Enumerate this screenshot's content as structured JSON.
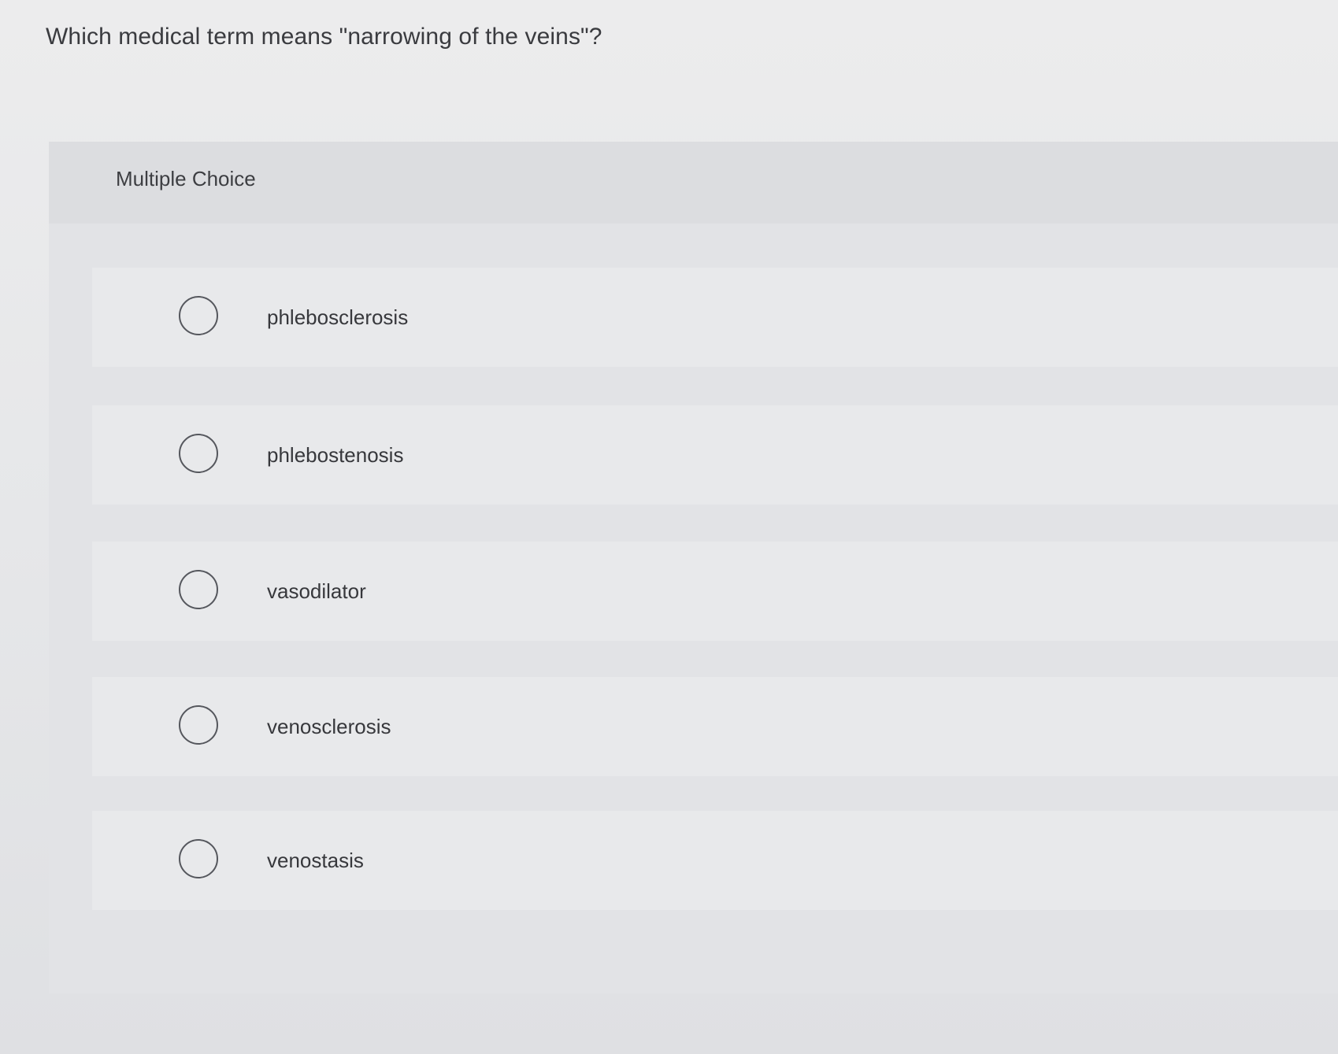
{
  "question": {
    "text": "Which medical term means \"narrowing of the veins\"?"
  },
  "card": {
    "header_label": "Multiple Choice",
    "options": [
      {
        "label": "phlebosclerosis",
        "selected": false
      },
      {
        "label": "phlebostenosis",
        "selected": false
      },
      {
        "label": "vasodilator",
        "selected": false
      },
      {
        "label": "venosclerosis",
        "selected": false
      },
      {
        "label": "venostasis",
        "selected": false
      }
    ]
  }
}
